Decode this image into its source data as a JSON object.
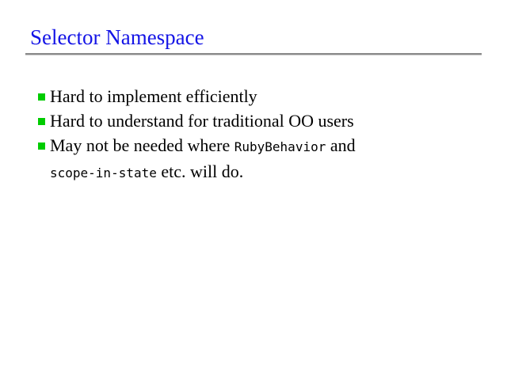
{
  "slide": {
    "title": "Selector Namespace",
    "bullets": [
      {
        "text": "Hard to implement efficiently"
      },
      {
        "text": "Hard to understand for traditional OO users"
      },
      {
        "part1": "May not be needed where ",
        "code1": "RubyBehavior",
        "part2": " and",
        "code2": "scope-in-state",
        "part3": " etc. will do."
      }
    ]
  },
  "colors": {
    "title": "#1414e6",
    "bullet": "#00cc00",
    "rule": "#8a8a8a"
  }
}
